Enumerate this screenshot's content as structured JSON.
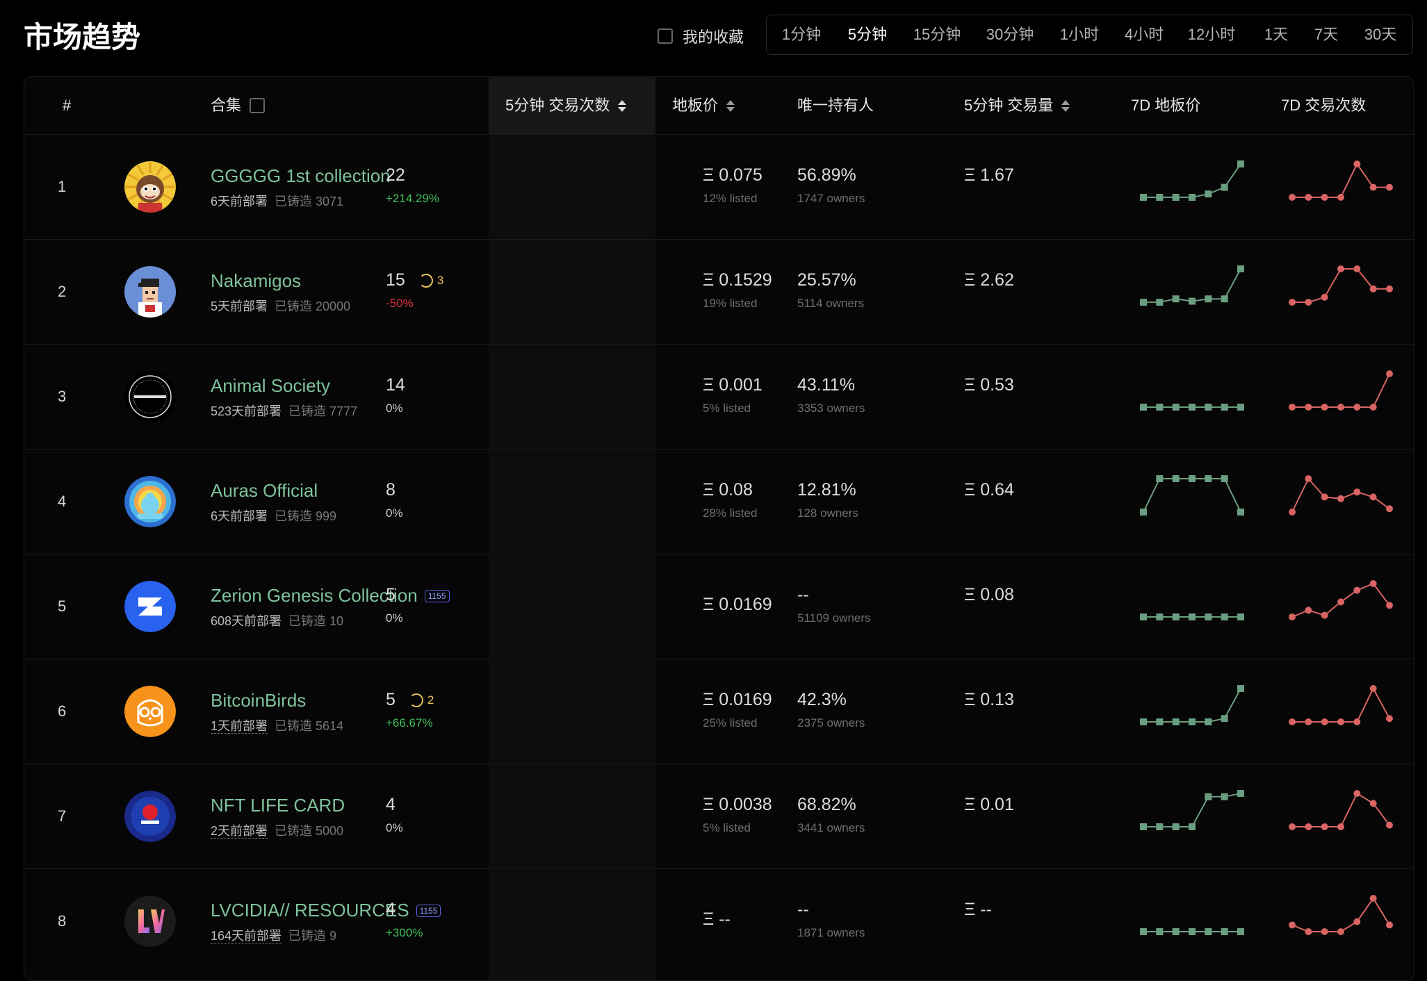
{
  "header": {
    "title": "市场趋势",
    "favorites_label": "我的收藏",
    "time_options": [
      "1分钟",
      "5分钟",
      "15分钟",
      "30分钟",
      "1小时",
      "4小时",
      "12小时",
      "1天",
      "7天",
      "30天"
    ],
    "active_time": "5分钟"
  },
  "table": {
    "columns": {
      "index": "#",
      "collection": "合集",
      "trades": "5分钟 交易次数",
      "floor": "地板价",
      "holders": "唯一持有人",
      "volume": "5分钟 交易量",
      "floor_7d": "7D 地板价",
      "trades_7d": "7D 交易次数"
    },
    "colors": {
      "name": "#7fc29b",
      "floor_spark": "#6a9e80",
      "trades_spark": "#d96464",
      "positive": "#3fbf5c",
      "negative": "#e2323e",
      "pending": "#e8c45a"
    },
    "rows": [
      {
        "index": "1",
        "name": "GGGGG 1st collection",
        "deployed": "6天前部署",
        "minted": "已铸造 3071",
        "trades": "22",
        "pending": "",
        "change": "+214.29%",
        "change_type": "pos",
        "floor": "Ξ 0.075",
        "listed": "12% listed",
        "holders": "56.89%",
        "owners": "1747 owners",
        "volume": "Ξ 1.67",
        "badge": "",
        "avatar": "monkey-avatar",
        "floor_7d": [
          0,
          0,
          0,
          0,
          0.1,
          0.3,
          1
        ],
        "trades_7d": [
          0,
          0,
          0,
          0,
          1,
          0.3,
          0.3
        ]
      },
      {
        "index": "2",
        "name": "Nakamigos",
        "deployed": "5天前部署",
        "minted": "已铸造 20000",
        "trades": "15",
        "pending": "3",
        "change": "-50%",
        "change_type": "neg",
        "floor": "Ξ 0.1529",
        "listed": "19% listed",
        "holders": "25.57%",
        "owners": "5114 owners",
        "volume": "Ξ 2.62",
        "badge": "",
        "avatar": "pixel-avatar",
        "floor_7d": [
          0,
          0,
          0.1,
          0.03,
          0.1,
          0.1,
          1
        ],
        "trades_7d": [
          0,
          0,
          0.15,
          1,
          1,
          0.4,
          0.4
        ]
      },
      {
        "index": "3",
        "name": "Animal Society",
        "deployed": "523天前部署",
        "minted": "已铸造 7777",
        "trades": "14",
        "pending": "",
        "change": "0%",
        "change_type": "zero",
        "floor": "Ξ 0.001",
        "listed": "5% listed",
        "holders": "43.11%",
        "owners": "3353 owners",
        "volume": "Ξ 0.53",
        "badge": "",
        "avatar": "animal-society-logo",
        "floor_7d": [
          0,
          0,
          0,
          0,
          0,
          0,
          0
        ],
        "trades_7d": [
          0,
          0,
          0,
          0,
          0,
          0,
          1
        ]
      },
      {
        "index": "4",
        "name": "Auras Official",
        "deployed": "6天前部署",
        "minted": "已铸造 999",
        "trades": "8",
        "pending": "",
        "change": "0%",
        "change_type": "zero",
        "floor": "Ξ 0.08",
        "listed": "28% listed",
        "holders": "12.81%",
        "owners": "128 owners",
        "volume": "Ξ 0.64",
        "badge": "",
        "avatar": "aura-avatar",
        "floor_7d": [
          0,
          1,
          1,
          1,
          1,
          1,
          0
        ],
        "trades_7d": [
          0,
          1,
          0.45,
          0.4,
          0.6,
          0.45,
          0.1
        ]
      },
      {
        "index": "5",
        "name": "Zerion Genesis Collection",
        "deployed": "608天前部署",
        "minted": "已铸造 10",
        "trades": "5",
        "pending": "",
        "change": "0%",
        "change_type": "zero",
        "floor": "Ξ 0.0169",
        "listed": "",
        "holders": "--",
        "owners": "51109 owners",
        "volume": "Ξ 0.08",
        "badge": "1155",
        "avatar": "zerion-logo",
        "floor_7d": [
          0,
          0,
          0,
          0,
          0,
          0,
          0
        ],
        "trades_7d": [
          0,
          0.2,
          0.05,
          0.45,
          0.8,
          1,
          0.35
        ]
      },
      {
        "index": "6",
        "name": "BitcoinBirds",
        "deployed": "1天前部署",
        "minted": "已铸造 5614",
        "trades": "5",
        "pending": "2",
        "change": "+66.67%",
        "change_type": "pos",
        "floor": "Ξ 0.0169",
        "listed": "25% listed",
        "holders": "42.3%",
        "owners": "2375 owners",
        "volume": "Ξ 0.13",
        "badge": "",
        "avatar": "owl-avatar",
        "floor_7d": [
          0,
          0,
          0,
          0,
          0,
          0.1,
          1
        ],
        "trades_7d": [
          0,
          0,
          0,
          0,
          0,
          1,
          0.1
        ]
      },
      {
        "index": "7",
        "name": "NFT LIFE CARD",
        "deployed": "2天前部署",
        "minted": "已铸造 5000",
        "trades": "4",
        "pending": "",
        "change": "0%",
        "change_type": "zero",
        "floor": "Ξ 0.0038",
        "listed": "5% listed",
        "holders": "68.82%",
        "owners": "3441 owners",
        "volume": "Ξ 0.01",
        "badge": "",
        "avatar": "nft-life-logo",
        "floor_7d": [
          0,
          0,
          0,
          0,
          0.9,
          0.9,
          1
        ],
        "trades_7d": [
          0,
          0,
          0,
          0,
          1,
          0.7,
          0.05
        ]
      },
      {
        "index": "8",
        "name": "LVCIDIA// RESOURCES",
        "deployed": "164天前部署",
        "minted": "已铸造 9",
        "trades": "4",
        "pending": "",
        "change": "+300%",
        "change_type": "pos",
        "floor": "Ξ --",
        "listed": "",
        "holders": "--",
        "owners": "1871 owners",
        "volume": "Ξ --",
        "badge": "1155",
        "avatar": "lv-logo",
        "floor_7d": [
          0,
          0,
          0,
          0,
          0,
          0,
          0
        ],
        "trades_7d": [
          0.2,
          0,
          0,
          0,
          0.3,
          1,
          0.2
        ]
      }
    ]
  }
}
